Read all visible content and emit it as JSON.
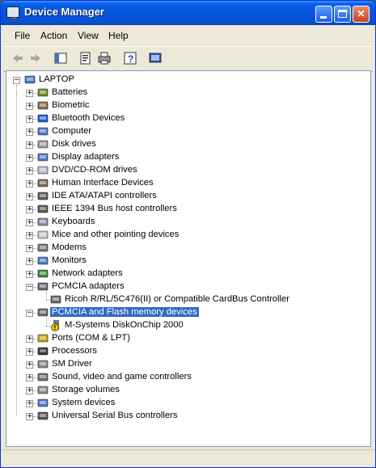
{
  "window": {
    "title": "Device Manager"
  },
  "menu": [
    "File",
    "Action",
    "View",
    "Help"
  ],
  "toolbar": [
    "back-arrow-icon",
    "forward-arrow-icon",
    "show-hide-tree-icon",
    "properties-icon",
    "print-icon",
    "help-icon",
    "scan-hardware-icon"
  ],
  "tree": {
    "root": "LAPTOP",
    "categories": [
      {
        "label": "Batteries",
        "icon": "battery-icon"
      },
      {
        "label": "Biometric",
        "icon": "biometric-icon"
      },
      {
        "label": "Bluetooth Devices",
        "icon": "bluetooth-icon"
      },
      {
        "label": "Computer",
        "icon": "computer-icon"
      },
      {
        "label": "Disk drives",
        "icon": "disk-drive-icon"
      },
      {
        "label": "Display adapters",
        "icon": "display-adapter-icon"
      },
      {
        "label": "DVD/CD-ROM drives",
        "icon": "dvd-drive-icon"
      },
      {
        "label": "Human Interface Devices",
        "icon": "hid-icon"
      },
      {
        "label": "IDE ATA/ATAPI controllers",
        "icon": "ide-controller-icon"
      },
      {
        "label": "IEEE 1394 Bus host controllers",
        "icon": "ieee1394-icon"
      },
      {
        "label": "Keyboards",
        "icon": "keyboard-icon"
      },
      {
        "label": "Mice and other pointing devices",
        "icon": "mouse-icon"
      },
      {
        "label": "Modems",
        "icon": "modem-icon"
      },
      {
        "label": "Monitors",
        "icon": "monitor-icon"
      },
      {
        "label": "Network adapters",
        "icon": "network-adapter-icon"
      },
      {
        "label": "PCMCIA adapters",
        "icon": "pcmcia-icon",
        "expanded": true,
        "children": [
          {
            "label": "Ricoh R/RL/5C476(II) or Compatible CardBus Controller",
            "icon": "pcmcia-card-icon"
          }
        ]
      },
      {
        "label": "PCMCIA and Flash memory devices",
        "icon": "pcmcia-icon",
        "expanded": true,
        "selected": true,
        "children": [
          {
            "label": "M-Systems DiskOnChip 2000",
            "icon": "warning-device-icon"
          }
        ]
      },
      {
        "label": "Ports (COM & LPT)",
        "icon": "port-icon"
      },
      {
        "label": "Processors",
        "icon": "processor-icon"
      },
      {
        "label": "SM Driver",
        "icon": "sm-driver-icon"
      },
      {
        "label": "Sound, video and game controllers",
        "icon": "sound-icon"
      },
      {
        "label": "Storage volumes",
        "icon": "storage-volume-icon"
      },
      {
        "label": "System devices",
        "icon": "system-device-icon"
      },
      {
        "label": "Universal Serial Bus controllers",
        "icon": "usb-icon"
      }
    ]
  },
  "colors": {
    "title_bar": "#0355dc",
    "selection": "#316ac5",
    "window_bg": "#ece9d8"
  }
}
